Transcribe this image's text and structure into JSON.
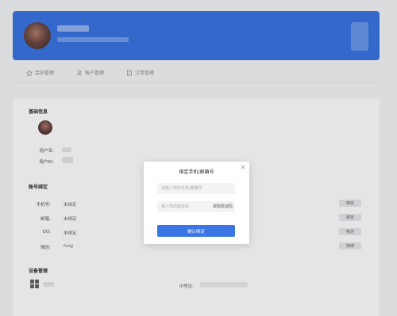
{
  "nav": {
    "items": [
      {
        "label": "会员管理",
        "icon": "home-icon"
      },
      {
        "label": "账户管理",
        "icon": "user-icon"
      },
      {
        "label": "订单管理",
        "icon": "order-icon"
      }
    ]
  },
  "basic": {
    "title": "基础信息",
    "username_label": "用户名:",
    "userid_label": "用户ID:"
  },
  "account": {
    "title": "账号绑定",
    "rows": [
      {
        "label": "手机号:",
        "value": "未绑定",
        "action": "绑定"
      },
      {
        "label": "邮箱:",
        "value": "未绑定",
        "action": "绑定"
      },
      {
        "label": "QQ:",
        "value": "未绑定",
        "action": "绑定"
      },
      {
        "label": "微信:",
        "value": "fxxg",
        "action": "换绑"
      }
    ]
  },
  "device": {
    "title": "设备管理",
    "ip_label": "IP地址:"
  },
  "modal": {
    "title": "绑定手机/邮箱号",
    "phone_placeholder": "请输入你的手机/邮箱号",
    "code_placeholder": "输入你的验证码",
    "code_button": "获取验证码",
    "confirm_button": "确认绑定"
  },
  "colors": {
    "accent": "#3a75e3",
    "panel": "#ffffff",
    "background": "#f4f5f7"
  }
}
